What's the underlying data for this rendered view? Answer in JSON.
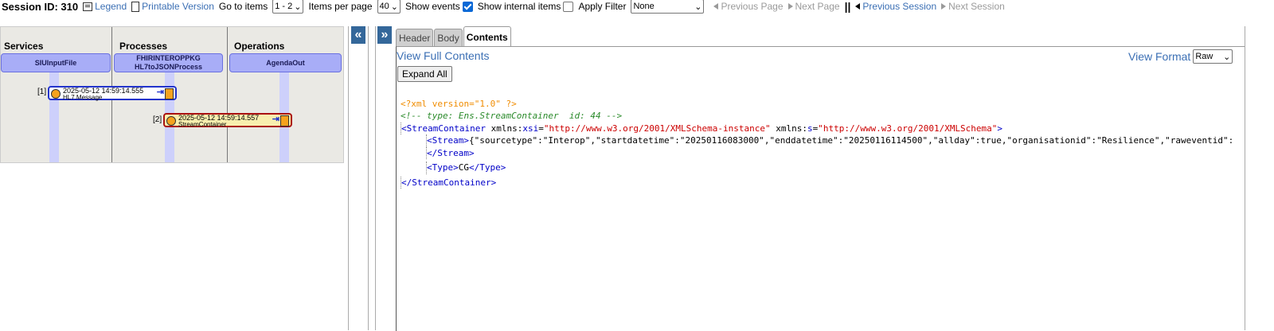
{
  "toolbar": {
    "session_label": "Session ID: 310",
    "legend": "Legend",
    "printable": "Printable Version",
    "goto_label": "Go to items",
    "goto_value": "1 - 2",
    "per_page_label": "Items per page",
    "per_page_value": "40",
    "show_events": "Show events",
    "show_internal": "Show internal items",
    "apply_filter": "Apply Filter",
    "filter_value": "None",
    "prev_page": "Previous Page",
    "next_page": "Next Page",
    "separator": "||",
    "prev_session": "Previous Session",
    "next_session": "Next Session"
  },
  "diagram": {
    "columns": [
      {
        "title": "Services",
        "head": [
          "SIUInputFile"
        ]
      },
      {
        "title": "Processes",
        "head": [
          "FHIRINTEROPPKG",
          "HL7toJSONProcess"
        ]
      },
      {
        "title": "Operations",
        "head": [
          "AgendaOut"
        ]
      }
    ],
    "messages": [
      {
        "index": "[1]",
        "time": "2025-05-12 14:59:14.555",
        "type": "HL7.Message"
      },
      {
        "index": "[2]",
        "time": "2025-05-12 14:59:14.557",
        "type": "StreamContainer"
      }
    ]
  },
  "splitter": {
    "left_btn": "«",
    "right_btn": "»"
  },
  "tabs": [
    "Header",
    "Body",
    "Contents"
  ],
  "contents": {
    "view_full": "View Full Contents",
    "view_format_label": "View Format",
    "view_format_value": "Raw",
    "expand_all": "Expand All",
    "xml_decl": "<?xml version=\"1.0\" ?>",
    "comment": "<!-- type: Ens.StreamContainer  id: 44 -->",
    "root_tag": "StreamContainer",
    "attr1_ns": "xmlns:",
    "attr1_name": "xsi",
    "attr1_val": "\"http://www.w3.org/2001/XMLSchema-instance\"",
    "attr2_ns": "xmlns:",
    "attr2_name": "s",
    "attr2_val": "\"http://www.w3.org/2001/XMLSchema\"",
    "stream_tag": "Stream",
    "stream_text": "{\"sourcetype\":\"Interop\",\"startdatetime\":\"20250116083000\",\"enddatetime\":\"20250116114500\",\"allday\":true,\"organisationid\":\"Resilience\",\"raweventid\":\"",
    "type_tag": "Type",
    "type_text": "CG"
  }
}
